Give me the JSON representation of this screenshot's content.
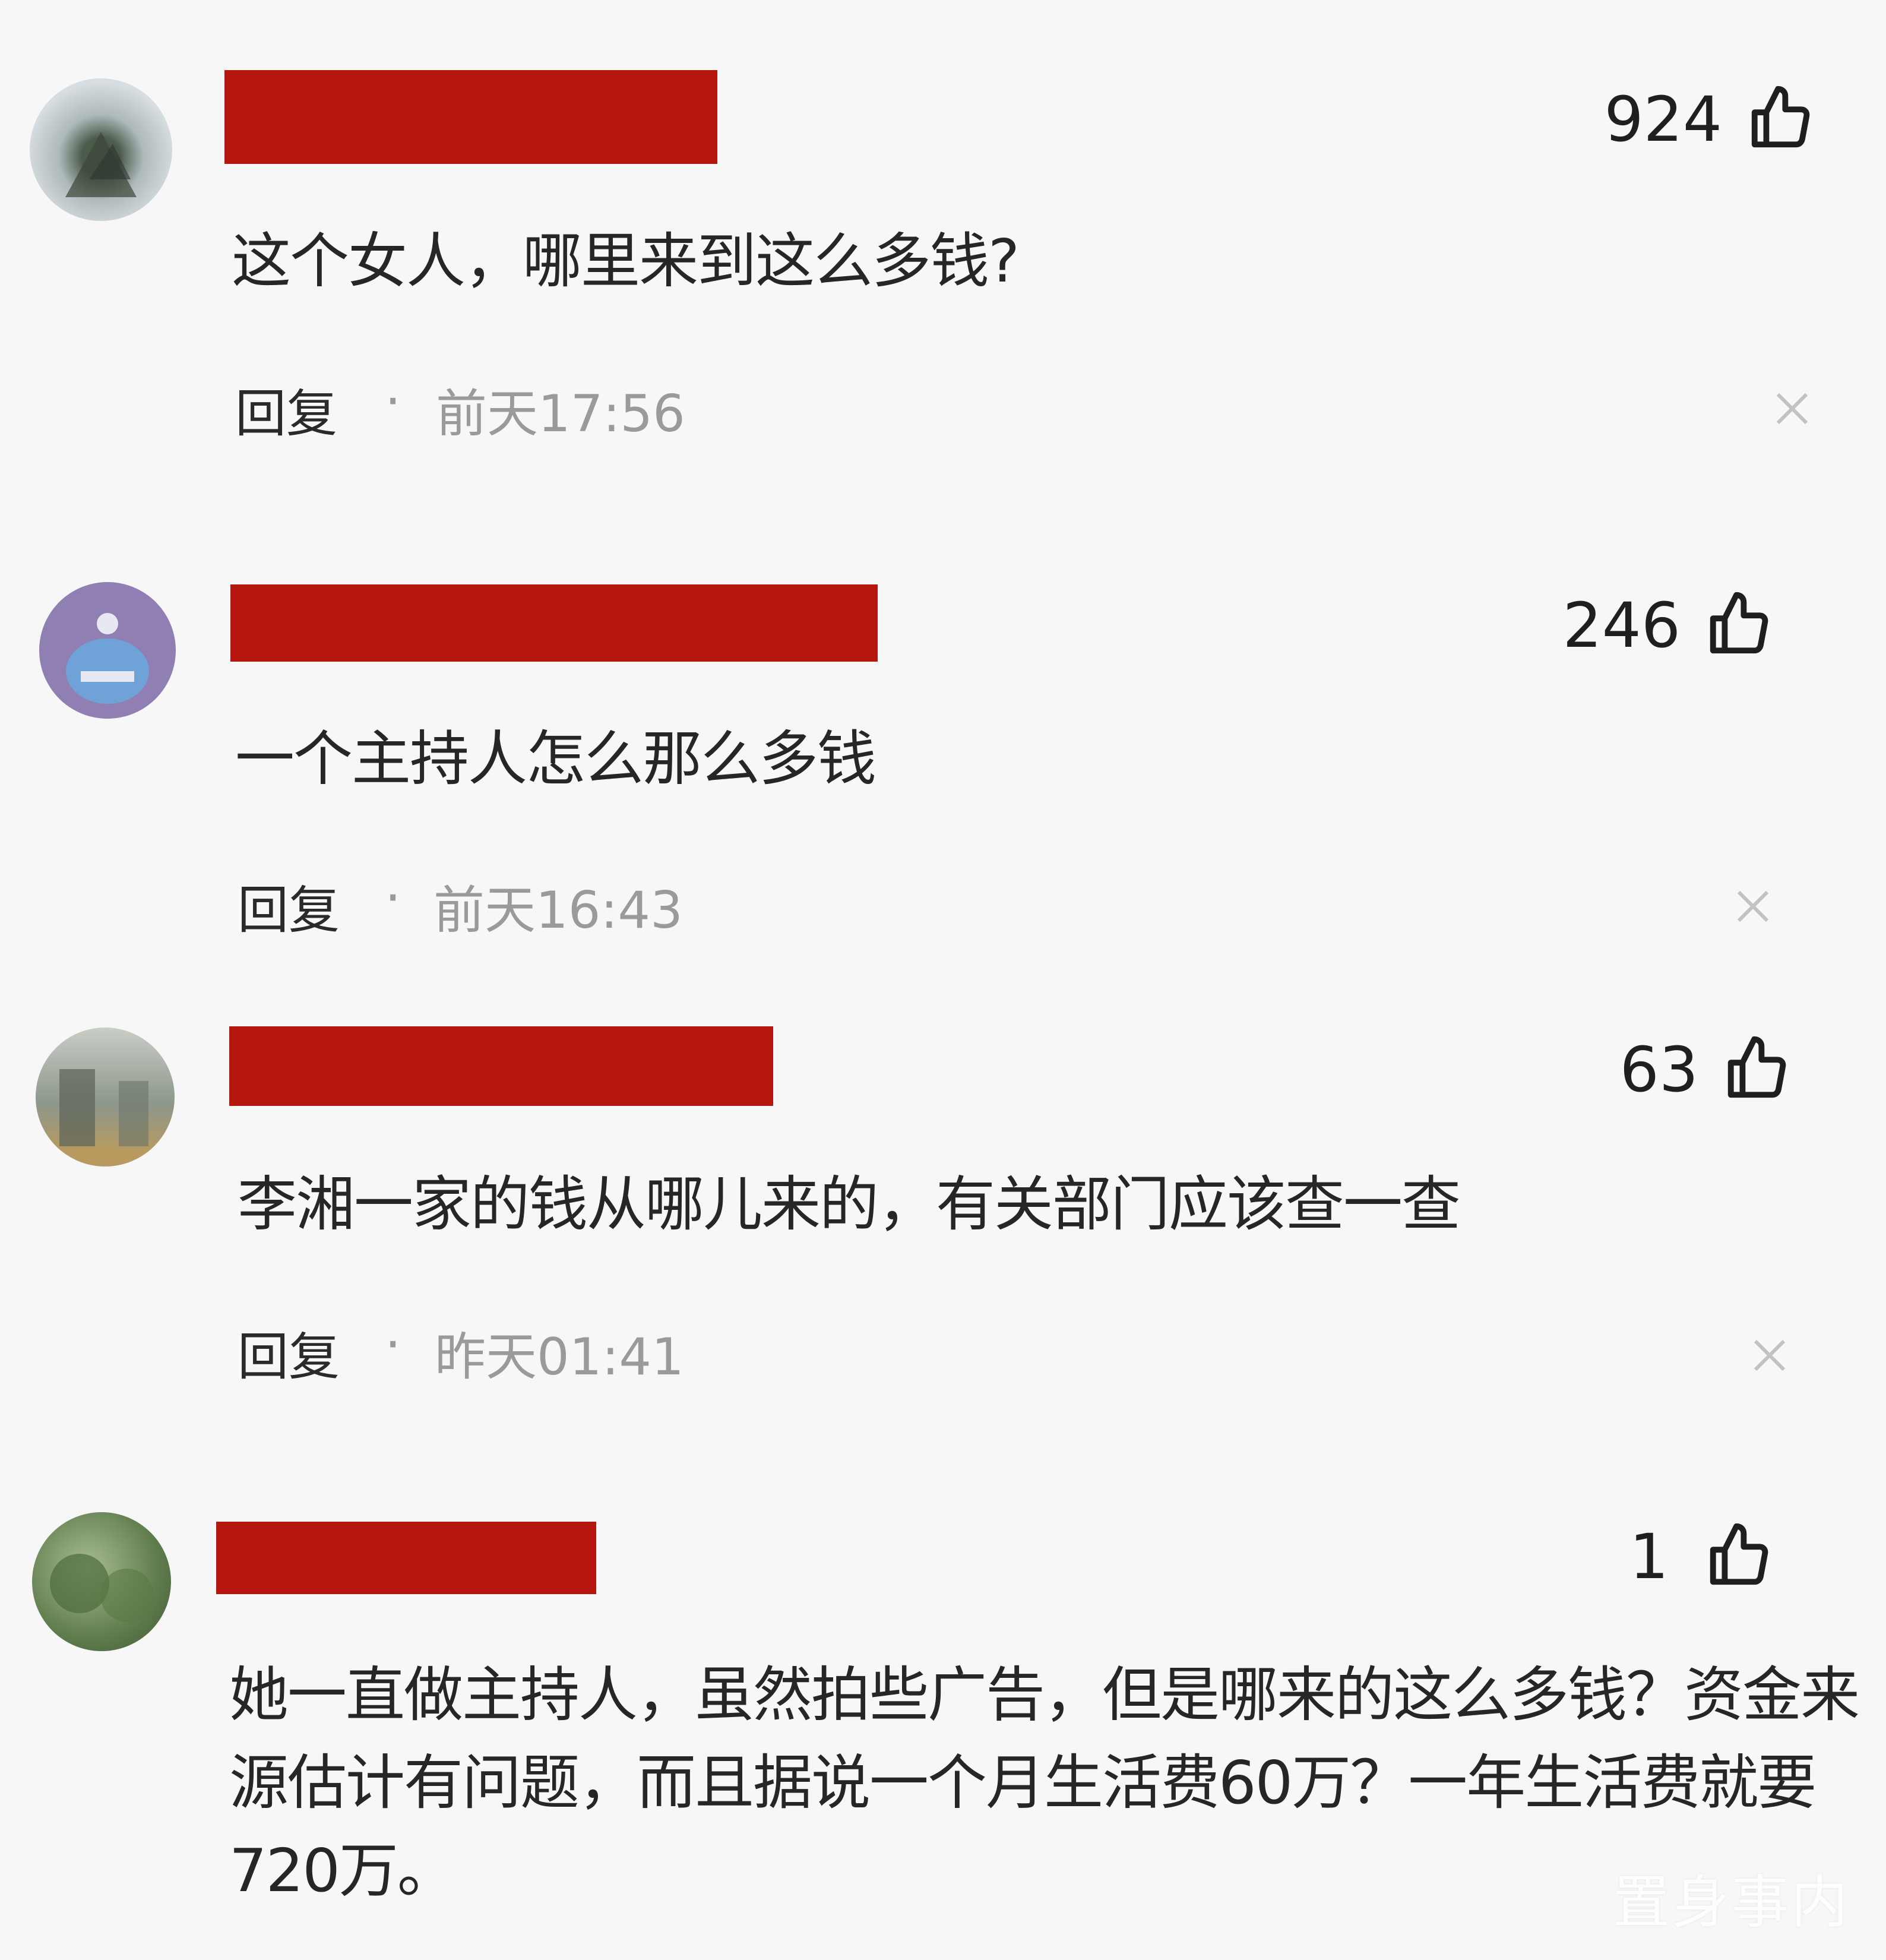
{
  "comments": [
    {
      "text": "这个女人，哪里来到这么多钱?",
      "likes": "924",
      "reply_label": "回复",
      "separator": "·",
      "time": "前天17:56",
      "avatar_color": "#a9b3b5"
    },
    {
      "text": "一个主持人怎么那么多钱",
      "likes": "246",
      "reply_label": "回复",
      "separator": "·",
      "time": "前天16:43",
      "avatar_color": "#8f7fb2"
    },
    {
      "text": "李湘一家的钱从哪儿来的，有关部门应该查一查",
      "likes": "63",
      "reply_label": "回复",
      "separator": "·",
      "time": "昨天01:41",
      "avatar_color": "#9ea69c"
    },
    {
      "text": "她一直做主持人，虽然拍些广告，但是哪来的这么多钱？资金来源估计有问题，而且据说一个月生活费60万？一年生活费就要720万。",
      "likes": "1",
      "avatar_color": "#6f8a5f"
    }
  ],
  "colors": {
    "background": "#f7f7f7",
    "redaction": "#b5170e",
    "meta_gray": "#9a9a9a"
  },
  "watermark": "置身事内"
}
